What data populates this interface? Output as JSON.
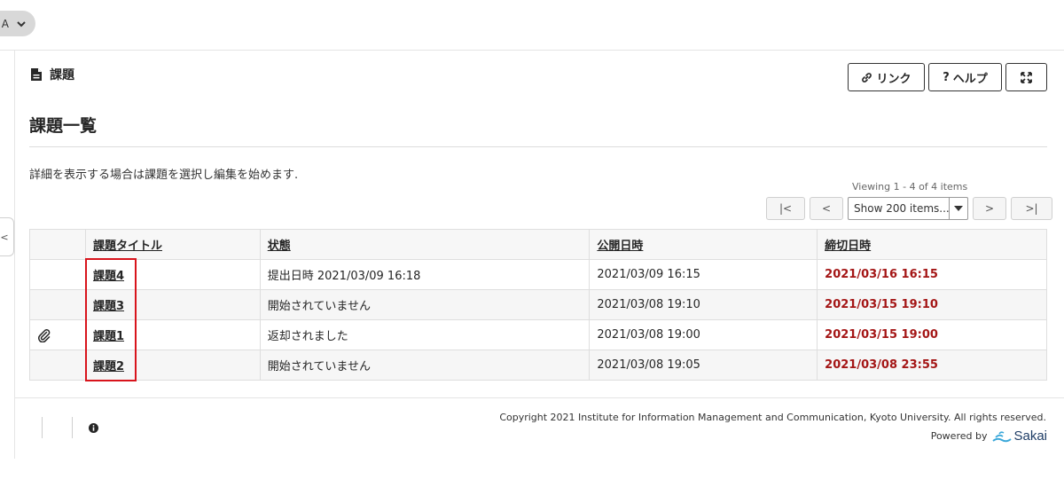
{
  "topbar": {
    "site_pill_text": "A"
  },
  "left_tab_label": "<",
  "tool": {
    "icon": "document-icon",
    "title": "課題"
  },
  "header_buttons": {
    "link_label": "リンク",
    "help_label": "ヘルプ",
    "help_prefix": "?"
  },
  "page_title": "課題一覧",
  "instructions": "詳細を表示する場合は課題を選択し編集を始めます.",
  "pager": {
    "viewing": "Viewing 1 - 4 of 4 items",
    "first": "|<",
    "prev": "<",
    "page_size": "Show 200 items...",
    "next": ">",
    "last": ">|"
  },
  "table": {
    "headers": {
      "title": "課題タイトル",
      "status": "状態",
      "open": "公開日時",
      "due": "締切日時"
    },
    "rows": [
      {
        "has_attachment": false,
        "title": "課題4",
        "status": "提出日時 2021/03/09 16:18",
        "open": "2021/03/09 16:15",
        "due": "2021/03/16 16:15"
      },
      {
        "has_attachment": false,
        "title": "課題3",
        "status": "開始されていません",
        "open": "2021/03/08 19:10",
        "due": "2021/03/15 19:10"
      },
      {
        "has_attachment": true,
        "title": "課題1",
        "status": "返却されました",
        "open": "2021/03/08 19:00",
        "due": "2021/03/15 19:00"
      },
      {
        "has_attachment": false,
        "title": "課題2",
        "status": "開始されていません",
        "open": "2021/03/08 19:05",
        "due": "2021/03/08 23:55"
      }
    ]
  },
  "footer": {
    "copyright": "Copyright 2021 Institute for Information Management and Communication, Kyoto University. All rights reserved.",
    "powered_by": "Powered by",
    "brand": "Sakai"
  },
  "colors": {
    "due_red": "#a41616",
    "highlight_red": "#d8141c",
    "sakai_blue": "#1f3d66"
  }
}
